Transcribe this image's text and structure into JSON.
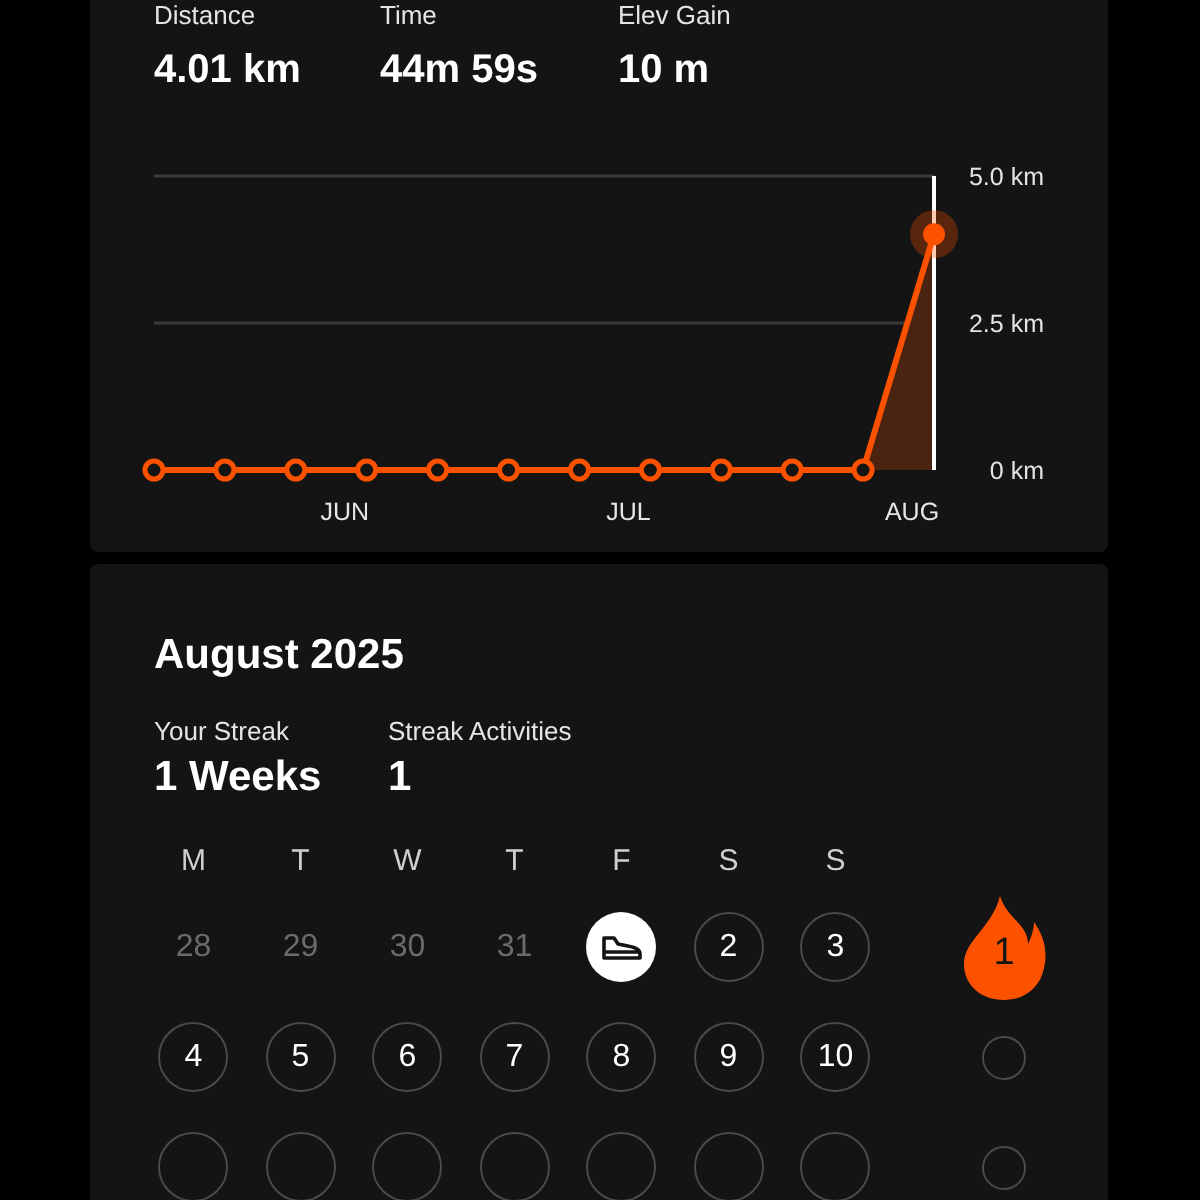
{
  "summary": {
    "stats": [
      {
        "label": "Distance",
        "value": "4.01 km"
      },
      {
        "label": "Time",
        "value": "44m 59s"
      },
      {
        "label": "Elev Gain",
        "value": "10 m"
      }
    ],
    "chart_data": {
      "type": "line",
      "categories": [
        null,
        null,
        null,
        "JUN",
        null,
        null,
        null,
        "JUL",
        null,
        null,
        null,
        "AUG"
      ],
      "ylim": [
        0,
        5
      ],
      "yticks": [
        {
          "value": 0,
          "label": "0 km"
        },
        {
          "value": 2.5,
          "label": "2.5 km"
        },
        {
          "value": 5,
          "label": "5.0 km"
        }
      ],
      "series": [
        {
          "color": "#fc5200",
          "marker": "circle",
          "values": [
            0,
            0,
            0,
            0,
            0,
            0,
            0,
            0,
            0,
            0,
            0,
            4.01
          ]
        }
      ]
    }
  },
  "calendar": {
    "title": "August 2025",
    "stats": [
      {
        "label": "Your Streak",
        "value": "1 Weeks"
      },
      {
        "label": "Streak Activities",
        "value": "1"
      }
    ],
    "weekdays": [
      "M",
      "T",
      "W",
      "T",
      "F",
      "S",
      "S"
    ],
    "weeks": [
      {
        "streak": {
          "kind": "flame",
          "label": "1"
        },
        "days": [
          {
            "kind": "outside",
            "label": "28"
          },
          {
            "kind": "outside",
            "label": "29"
          },
          {
            "kind": "outside",
            "label": "30"
          },
          {
            "kind": "outside",
            "label": "31"
          },
          {
            "kind": "activity"
          },
          {
            "kind": "day",
            "label": "2"
          },
          {
            "kind": "day",
            "label": "3"
          }
        ]
      },
      {
        "streak": {
          "kind": "empty"
        },
        "days": [
          {
            "kind": "day",
            "label": "4"
          },
          {
            "kind": "day",
            "label": "5"
          },
          {
            "kind": "day",
            "label": "6"
          },
          {
            "kind": "day",
            "label": "7"
          },
          {
            "kind": "day",
            "label": "8"
          },
          {
            "kind": "day",
            "label": "9"
          },
          {
            "kind": "day",
            "label": "10"
          }
        ]
      },
      {
        "streak": {
          "kind": "empty"
        },
        "days": [
          {
            "kind": "cut"
          },
          {
            "kind": "cut"
          },
          {
            "kind": "cut"
          },
          {
            "kind": "cut"
          },
          {
            "kind": "cut"
          },
          {
            "kind": "cut"
          },
          {
            "kind": "cut"
          }
        ]
      }
    ]
  }
}
